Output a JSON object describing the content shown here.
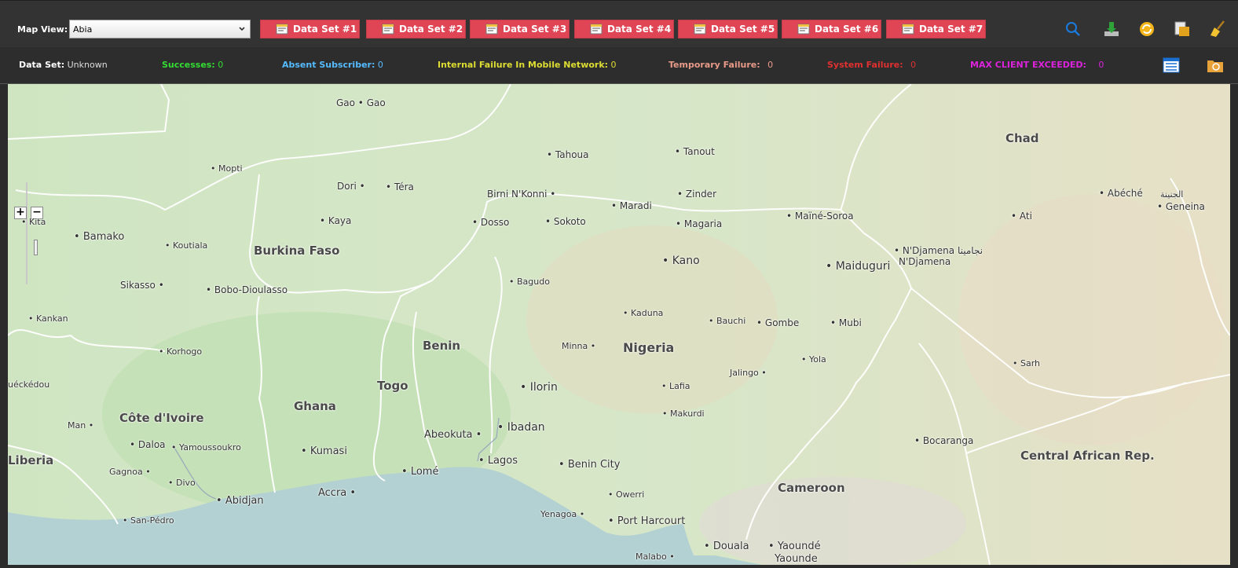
{
  "toolbar": {
    "map_view_label": "Map View:",
    "map_view_value": "Abia",
    "dataset_buttons": [
      "Data Set #1",
      "Data Set #2",
      "Data Set #3",
      "Data Set #4",
      "Data Set #5",
      "Data Set #6",
      "Data Set #7"
    ],
    "tools": [
      "search-icon",
      "download-icon",
      "refresh-icon",
      "clipboard-icon",
      "broom-icon"
    ],
    "colors": {
      "button_bg": "#e04555",
      "bar_bg": "#333333"
    }
  },
  "status": {
    "dataset_label": "Data Set:",
    "dataset_value": "Unknown",
    "successes_label": "Successes:",
    "successes_value": "0",
    "absent_label": "Absent Subscriber:",
    "absent_value": "0",
    "internal_label": "Internal Failure In Mobile Network:",
    "internal_value": "0",
    "temporary_label": "Temporary Failure:",
    "temporary_value": "0",
    "system_label": "System Failure:",
    "system_value": "0",
    "max_label": "MAX CLIENT EXCEEDED:",
    "max_value": "0",
    "colors": {
      "successes": "#33dd33",
      "absent": "#55bbff",
      "internal": "#dddd33",
      "temporary": "#e89a88",
      "system": "#e03030",
      "max": "#dd22dd"
    }
  },
  "map": {
    "zoom_in": "+",
    "zoom_out": "−",
    "countries": [
      "Chad",
      "Burkina Faso",
      "Benin",
      "Nigeria",
      "Togo",
      "Ghana",
      "Côte d'Ivoire",
      "Liberia",
      "Cameroon",
      "Central African Rep."
    ],
    "cities": [
      "Gao • Gao",
      "Tahoua",
      "Tanout",
      "Mopti",
      "Dori",
      "Téra",
      "Birni N'Konni",
      "Zinder",
      "Maradi",
      "Maïné-Soroa",
      "Abéché",
      "الجنينة",
      "Geneina",
      "Kita",
      "Bamako",
      "Kaya",
      "Dosso",
      "Sokoto",
      "Magaria",
      "Ati",
      "N'Djamena نجامينا",
      "N'Djamena",
      "Koutiala",
      "Kano",
      "Maiduguri",
      "Sikasso",
      "Bobo-Dioulasso",
      "Bagudo",
      "Kankan",
      "Kaduna",
      "Bauchi",
      "Gombe",
      "Mubi",
      "Korhogo",
      "Minna",
      "Sarh",
      "Jalingo",
      "Yola",
      "uéckédou",
      "Ilorin",
      "Lafia",
      "Makurdi",
      "Man",
      "Abeokuta",
      "Ibadan",
      "Daloa",
      "Yamoussoukro",
      "Kumasi",
      "Bocaranga",
      "Lagos",
      "Benin City",
      "Gagnoa",
      "Lomé",
      "Divo",
      "Accra",
      "Abidjan",
      "Owerri",
      "Yenagoa",
      "Port Harcourt",
      "San-Pédro",
      "Douala",
      "Yaoundé",
      "Yaounde",
      "Malabo"
    ]
  }
}
